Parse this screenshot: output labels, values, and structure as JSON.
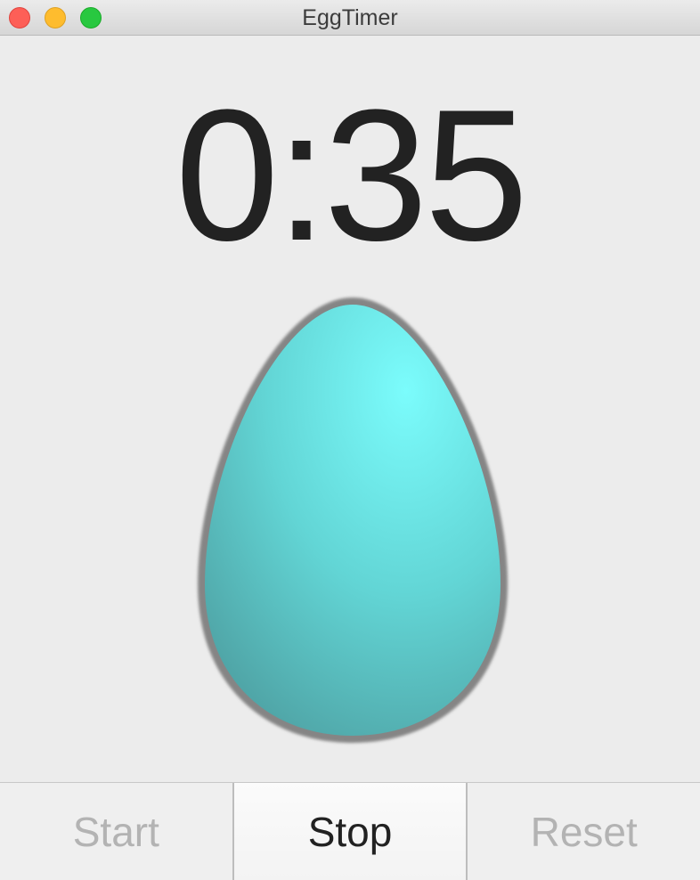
{
  "window": {
    "title": "EggTimer"
  },
  "timer": {
    "display": "0:35"
  },
  "egg": {
    "icon": "egg-icon",
    "fill_light": "#7bfcfc",
    "fill_dark": "#4d9ea0",
    "outline": "#858585"
  },
  "buttons": {
    "start_label": "Start",
    "stop_label": "Stop",
    "reset_label": "Reset"
  }
}
